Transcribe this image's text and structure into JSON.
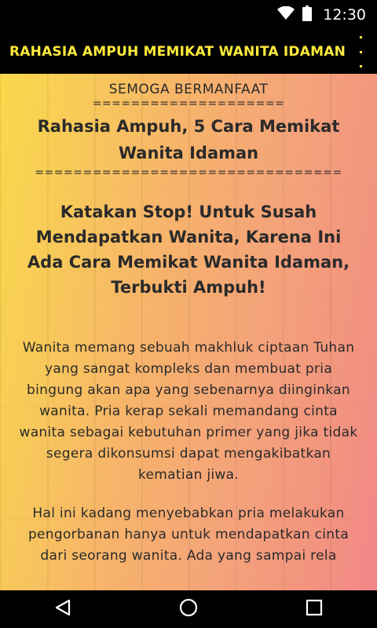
{
  "status_bar": {
    "time": "12:30",
    "icons": [
      "wifi-icon",
      "battery-icon"
    ]
  },
  "app_bar": {
    "title": "RAHASIA AMPUH MEMIKAT WANITA IDAMAN"
  },
  "content": {
    "subtitle": "SEMOGA BERMANFAAT",
    "separator_short": "====================",
    "title": "Rahasia Ampuh, 5 Cara Memikat Wanita Idaman",
    "separator_long": "================================",
    "headline": "Katakan Stop! Untuk Susah Mendapatkan Wanita, Karena Ini Ada Cara Memikat Wanita Idaman, Terbukti Ampuh!",
    "paragraph1": "Wanita memang sebuah makhluk ciptaan Tuhan yang sangat kompleks dan membuat pria bingung akan apa yang sebenarnya diinginkan wanita. Pria kerap sekali memandang cinta wanita sebagai kebutuhan primer yang jika tidak segera dikonsumsi dapat mengakibatkan kematian jiwa.",
    "paragraph2": "Hal ini kadang menyebabkan pria melakukan pengorbanan hanya untuk mendapatkan cinta dari seorang wanita. Ada yang sampai rela"
  },
  "nav_bar": {
    "buttons": [
      "back-icon",
      "home-icon",
      "recents-icon"
    ]
  },
  "colors": {
    "accent": "#ffeb3b",
    "bar_bg": "#000000"
  }
}
